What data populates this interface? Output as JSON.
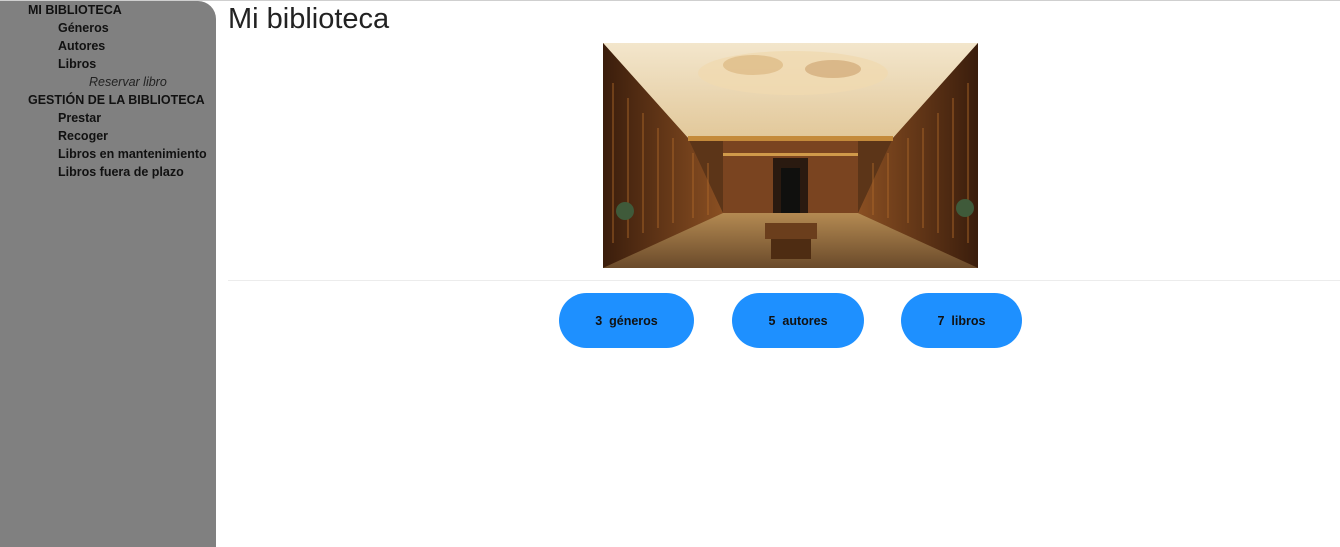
{
  "sidebar": {
    "items": [
      {
        "label": "MI BIBLIOTECA"
      },
      {
        "label": "Géneros"
      },
      {
        "label": "Autores"
      },
      {
        "label": "Libros"
      },
      {
        "label": "Reservar libro"
      },
      {
        "label": "GESTIÓN DE LA BIBLIOTECA"
      },
      {
        "label": "Prestar"
      },
      {
        "label": "Recoger"
      },
      {
        "label": "Libros en mantenimiento"
      },
      {
        "label": "Libros fuera de plazo"
      }
    ]
  },
  "main": {
    "title": "Mi biblioteca",
    "stats": [
      {
        "count": "3",
        "label": "géneros"
      },
      {
        "count": "5",
        "label": "autores"
      },
      {
        "count": "7",
        "label": "libros"
      }
    ]
  },
  "colors": {
    "sidebar_bg": "#808080",
    "stat_button_bg": "#1e90ff"
  }
}
